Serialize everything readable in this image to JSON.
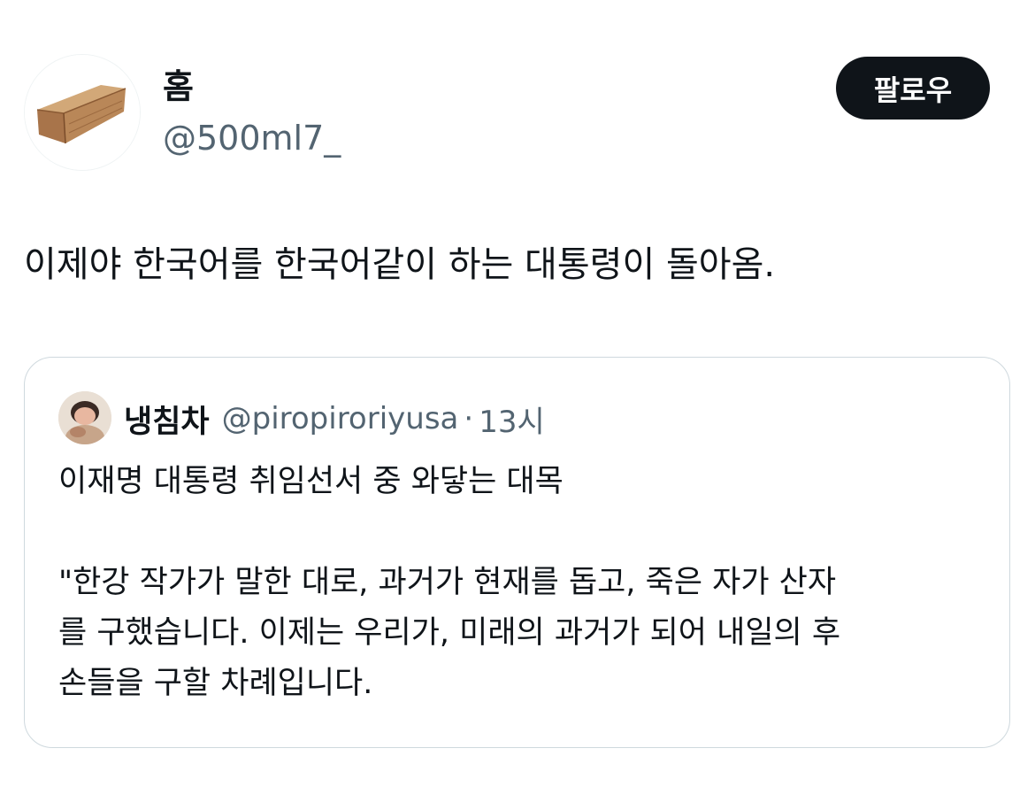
{
  "author": {
    "display_name": "홈",
    "handle": "@500ml7_",
    "avatar_icon": "wooden-coffin-avatar"
  },
  "actions": {
    "follow_label": "팔로우"
  },
  "tweet": {
    "text": "이제야 한국어를 한국어같이 하는 대통령이 돌아옴."
  },
  "quoted_tweet": {
    "author_name": "냉침차",
    "author_handle": "@piropiroriyusa",
    "separator": "·",
    "time": "13시",
    "lines": [
      "이재명 대통령 취임선서 중 와닿는 대목",
      "\"한강 작가가 말한 대로, 과거가 현재를 돕고, 죽은 자가 산자",
      "를 구했습니다. 이제는 우리가, 미래의 과거가 되어 내일의 후",
      "손들을 구할 차례입니다."
    ]
  },
  "colors": {
    "text_primary": "#0f1419",
    "text_secondary": "#536471",
    "follow_bg": "#0f1419",
    "card_border": "#cfd9de"
  }
}
